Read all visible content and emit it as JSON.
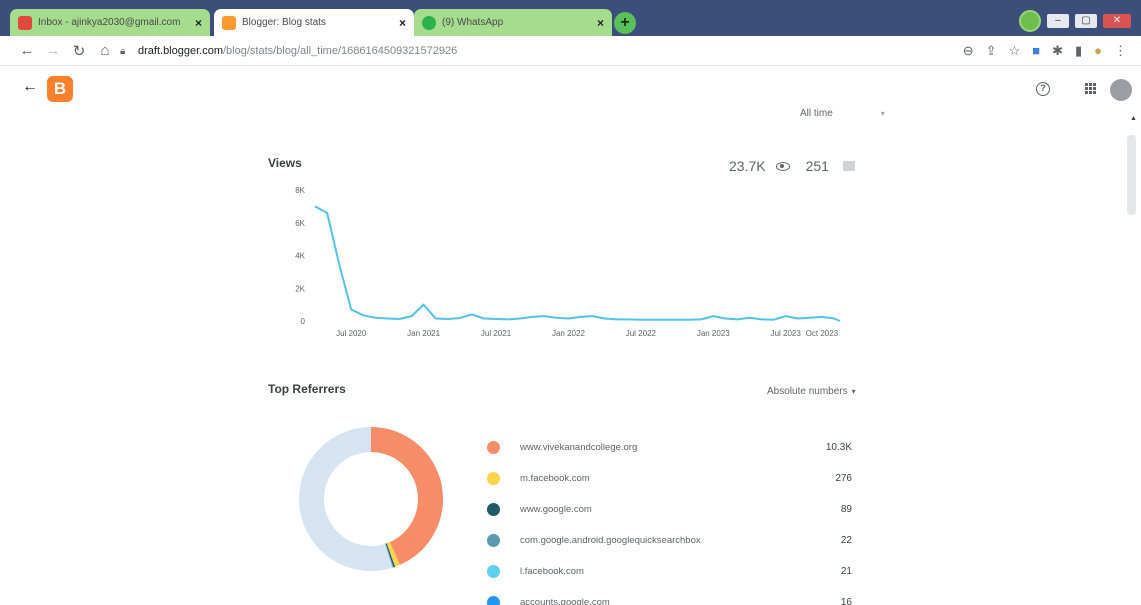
{
  "browser": {
    "tabs": [
      {
        "label": "Inbox - ajinkya2030@gmail.com",
        "close": "×"
      },
      {
        "label": "Blogger: Blog stats",
        "close": "×"
      },
      {
        "label": "(9) WhatsApp",
        "close": "×"
      }
    ],
    "new_tab": "+",
    "url_host": "draft.blogger.com",
    "url_path": "/blog/stats/blog/all_time/1686164509321572926"
  },
  "header": {
    "back": "←",
    "logo_letter": "B",
    "help": "?"
  },
  "range": {
    "label": "All time",
    "caret": "▾"
  },
  "views": {
    "title": "Views",
    "total": "23.7K",
    "posts": "251"
  },
  "chart_data": {
    "type": "line",
    "title": "Views",
    "yticks": [
      "0",
      "2K",
      "4K",
      "6K",
      "8K"
    ],
    "ylim": [
      0,
      8000
    ],
    "xticks": [
      {
        "label": "Jul 2020",
        "x": 1.0
      },
      {
        "label": "Jan 2021",
        "x": 7.0
      },
      {
        "label": "Jul 2021",
        "x": 13.0
      },
      {
        "label": "Jan 2022",
        "x": 19.0
      },
      {
        "label": "Jul 2022",
        "x": 25.0
      },
      {
        "label": "Jan 2023",
        "x": 31.0
      },
      {
        "label": "Jul 2023",
        "x": 37.0
      },
      {
        "label": "Oct 2023",
        "x": 40.0
      }
    ],
    "xlim": [
      -2.0,
      41.5
    ],
    "series": [
      {
        "color": "#4fc3e8",
        "x": [
          -2,
          -1,
          0,
          1,
          2,
          3,
          4,
          5,
          6,
          7,
          8,
          9,
          10,
          11,
          12,
          13,
          14,
          15,
          16,
          17,
          18,
          19,
          20,
          21,
          22,
          23,
          24,
          25,
          26,
          27,
          28,
          29,
          30,
          31,
          32,
          33,
          34,
          35,
          36,
          37,
          38,
          39,
          40,
          41,
          41.5
        ],
        "values": [
          7000,
          6600,
          3500,
          700,
          350,
          200,
          150,
          120,
          300,
          1000,
          150,
          120,
          180,
          400,
          150,
          120,
          100,
          150,
          250,
          300,
          200,
          150,
          250,
          300,
          150,
          100,
          100,
          80,
          80,
          80,
          80,
          80,
          100,
          300,
          150,
          100,
          200,
          100,
          80,
          300,
          150,
          200,
          250,
          150,
          0
        ]
      }
    ]
  },
  "referrers": {
    "title": "Top Referrers",
    "mode": "Absolute numbers",
    "caret": "▾",
    "items": [
      {
        "name": "www.vivekanandcollege.org",
        "count": "10.3K",
        "value": 10300,
        "color": "#f68c68"
      },
      {
        "name": "m.facebook.com",
        "count": "276",
        "value": 276,
        "color": "#fbd449"
      },
      {
        "name": "www.google.com",
        "count": "89",
        "value": 89,
        "color": "#205b6b"
      },
      {
        "name": "com.google.android.googlequicksearchbox",
        "count": "22",
        "value": 22,
        "color": "#5a9bb0"
      },
      {
        "name": "l.facebook.com",
        "count": "21",
        "value": 21,
        "color": "#5fd0ee"
      },
      {
        "name": "accounts.google.com",
        "count": "16",
        "value": 16,
        "color": "#2196f3"
      }
    ],
    "other_color": "#d6e3f1",
    "other_value": 13000
  }
}
